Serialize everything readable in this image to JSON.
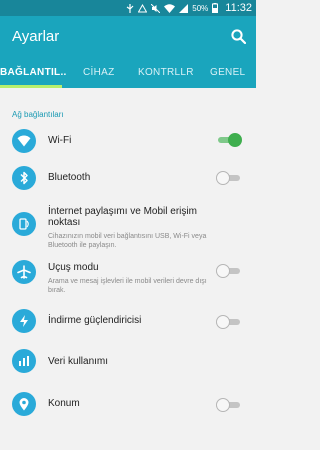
{
  "status_bar": {
    "battery": "50%",
    "time": "11:32"
  },
  "app_bar": {
    "title": "Ayarlar"
  },
  "tabs": [
    {
      "label": "BAĞLANTIL..",
      "active": true
    },
    {
      "label": "CİHAZ",
      "active": false
    },
    {
      "label": "KONTRLLR",
      "active": false
    },
    {
      "label": "GENEL",
      "active": false
    }
  ],
  "section_header": "Ağ bağlantıları",
  "items": [
    {
      "icon": "wifi-icon",
      "title": "Wi-Fi",
      "subtitle": "",
      "toggle": true,
      "toggle_on": true
    },
    {
      "icon": "bluetooth-icon",
      "title": "Bluetooth",
      "subtitle": "",
      "toggle": true,
      "toggle_on": false
    },
    {
      "icon": "tethering-icon",
      "title": "İnternet paylaşımı ve Mobil erişim noktası",
      "subtitle": "Cihazınızın mobil veri bağlantısını USB, Wi-Fi veya Bluetooth ile paylaşın.",
      "toggle": false,
      "toggle_on": false
    },
    {
      "icon": "airplane-icon",
      "title": "Uçuş modu",
      "subtitle": "Arama ve mesaj işlevleri ile mobil verileri devre dışı bırak.",
      "toggle": true,
      "toggle_on": false
    },
    {
      "icon": "download-booster-icon",
      "title": "İndirme güçlendiricisi",
      "subtitle": "",
      "toggle": true,
      "toggle_on": false
    },
    {
      "icon": "data-usage-icon",
      "title": "Veri kullanımı",
      "subtitle": "",
      "toggle": false,
      "toggle_on": false
    },
    {
      "icon": "location-icon",
      "title": "Konum",
      "subtitle": "",
      "toggle": true,
      "toggle_on": false
    }
  ],
  "colors": {
    "status_bar": "#18869a",
    "app_bar": "#1aa5bd",
    "tab_indicator": "#b7ef6c",
    "icon_circle": "#2aaad9",
    "toggle_on": "#3fae4e",
    "section_header": "#1a9ab3"
  }
}
